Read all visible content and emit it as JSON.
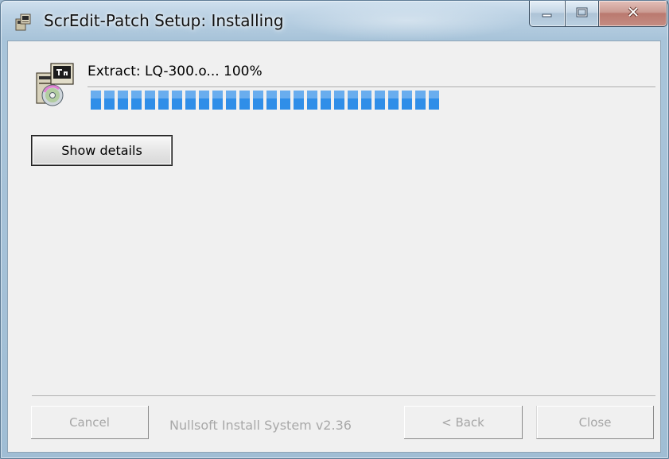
{
  "window": {
    "title": "ScrEdit-Patch Setup: Installing",
    "icons": {
      "app": "installer-app-icon",
      "minimize": "minimize-icon",
      "maximize": "maximize-icon",
      "close": "close-icon"
    }
  },
  "status": {
    "text": "Extract: LQ-300.o... 100%",
    "icon": "installer-disk-icon"
  },
  "progress": {
    "filled_fraction": 0.62,
    "color": "#2f8ee8"
  },
  "details_button": {
    "label": "Show details"
  },
  "footer": {
    "branding": "Nullsoft Install System v2.36",
    "cancel_label": "Cancel",
    "back_label": "< Back",
    "close_label": "Close"
  }
}
